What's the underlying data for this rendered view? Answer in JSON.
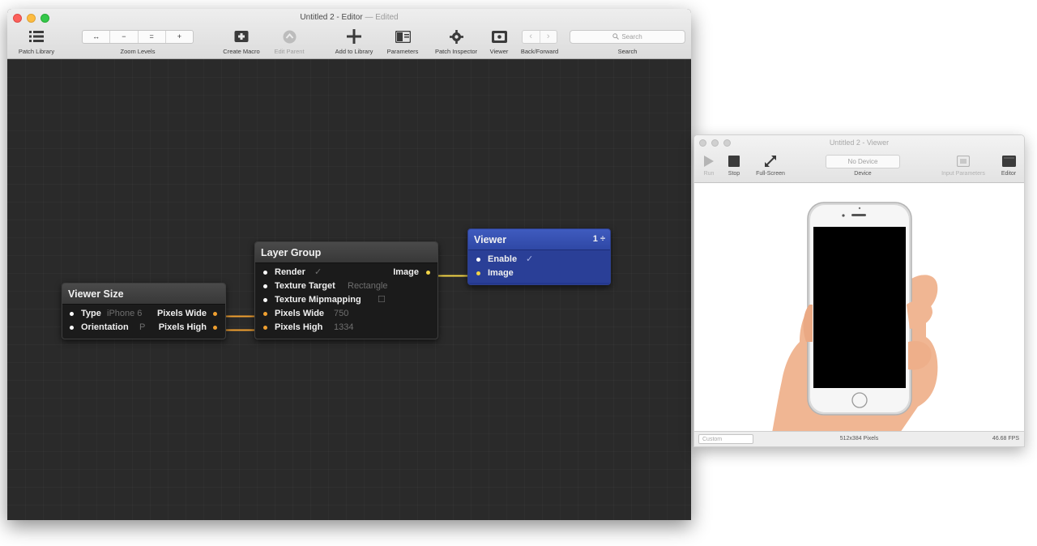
{
  "editor": {
    "title": "Untitled 2 - Editor",
    "title_separator": "—",
    "title_status": "Edited",
    "toolbar": {
      "patch_library": "Patch Library",
      "zoom_levels": "Zoom Levels",
      "zoom_buttons": [
        "↔",
        "−",
        "=",
        "+"
      ],
      "create_macro": "Create Macro",
      "edit_parent": "Edit Parent",
      "add_to_library": "Add to Library",
      "parameters": "Parameters",
      "patch_inspector": "Patch Inspector",
      "viewer": "Viewer",
      "back_forward": "Back/Forward",
      "search_label": "Search",
      "search_placeholder": "Search"
    },
    "patches": {
      "viewer_size": {
        "title": "Viewer Size",
        "inputs": [
          {
            "name": "Type",
            "value": "iPhone 6"
          },
          {
            "name": "Orientation",
            "value": "P"
          }
        ],
        "outputs": [
          "Pixels Wide",
          "Pixels High"
        ]
      },
      "layer_group": {
        "title": "Layer Group",
        "output": "Image",
        "inputs": [
          {
            "name": "Render",
            "value": "✓"
          },
          {
            "name": "Texture Target",
            "value": "Rectangle"
          },
          {
            "name": "Texture Mipmapping",
            "value": "☐"
          },
          {
            "name": "Pixels Wide",
            "value": "750"
          },
          {
            "name": "Pixels High",
            "value": "1334"
          }
        ]
      },
      "viewer": {
        "title": "Viewer",
        "badge": "1 ÷",
        "inputs": [
          {
            "name": "Enable",
            "value": "✓"
          },
          {
            "name": "Image",
            "value": ""
          }
        ]
      }
    }
  },
  "viewer_window": {
    "title": "Untitled 2 - Viewer",
    "toolbar": {
      "run": "Run",
      "stop": "Stop",
      "full_screen": "Full-Screen",
      "device_label": "Device",
      "device_value": "No Device",
      "input_parameters": "Input Parameters",
      "editor": "Editor"
    },
    "status": {
      "size_preset": "Custom",
      "pixels": "512x384 Pixels",
      "fps": "46.68 FPS"
    }
  },
  "colors": {
    "canvas": "#2a2a2a",
    "viewer_patch": "#2f48a6",
    "wire_orange": "#f0a030",
    "wire_yellow": "#f2d447"
  }
}
